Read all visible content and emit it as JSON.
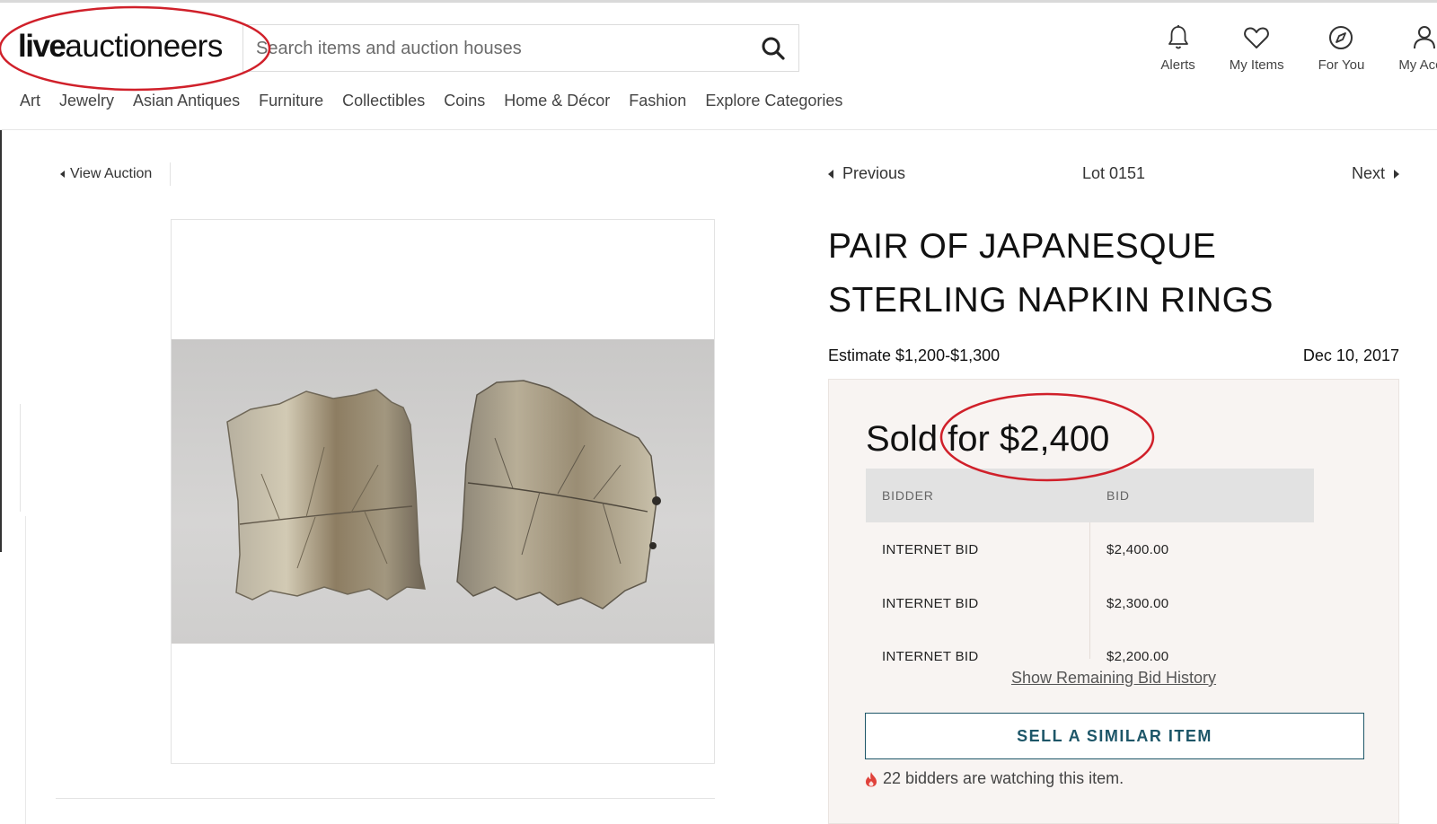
{
  "header": {
    "logo_bold": "live",
    "logo_light": "auctioneers",
    "search_placeholder": "Search items and auction houses",
    "nav": [
      {
        "label": "Alerts",
        "icon": "bell-icon"
      },
      {
        "label": "My Items",
        "icon": "heart-icon"
      },
      {
        "label": "For You",
        "icon": "compass-icon"
      },
      {
        "label": "My Acco",
        "icon": "user-icon"
      }
    ],
    "categories": [
      "Art",
      "Jewelry",
      "Asian Antiques",
      "Furniture",
      "Collectibles",
      "Coins",
      "Home & Décor",
      "Fashion",
      "Explore Categories"
    ]
  },
  "breadcrumb": {
    "view_auction": "View Auction"
  },
  "lot_nav": {
    "previous": "Previous",
    "lot": "Lot 0151",
    "next": "Next"
  },
  "item": {
    "title": "PAIR OF JAPANESQUE STERLING NAPKIN RINGS",
    "estimate": "Estimate $1,200-$1,300",
    "date": "Dec 10, 2017",
    "image_icon": "napkin-rings-photo"
  },
  "sold": {
    "text": "Sold for $2,400",
    "table": {
      "headers": [
        "BIDDER",
        "BID"
      ],
      "rows": [
        [
          "INTERNET BID",
          "$2,400.00"
        ],
        [
          "INTERNET BID",
          "$2,300.00"
        ],
        [
          "INTERNET BID",
          "$2,200.00"
        ]
      ]
    },
    "show_remaining": "Show Remaining Bid History",
    "sell_button": "SELL A SIMILAR ITEM",
    "watching": "22 bidders are watching this item."
  },
  "colors": {
    "accent": "#1d5668",
    "annotation": "#d0202a",
    "panel": "#f8f4f2"
  }
}
